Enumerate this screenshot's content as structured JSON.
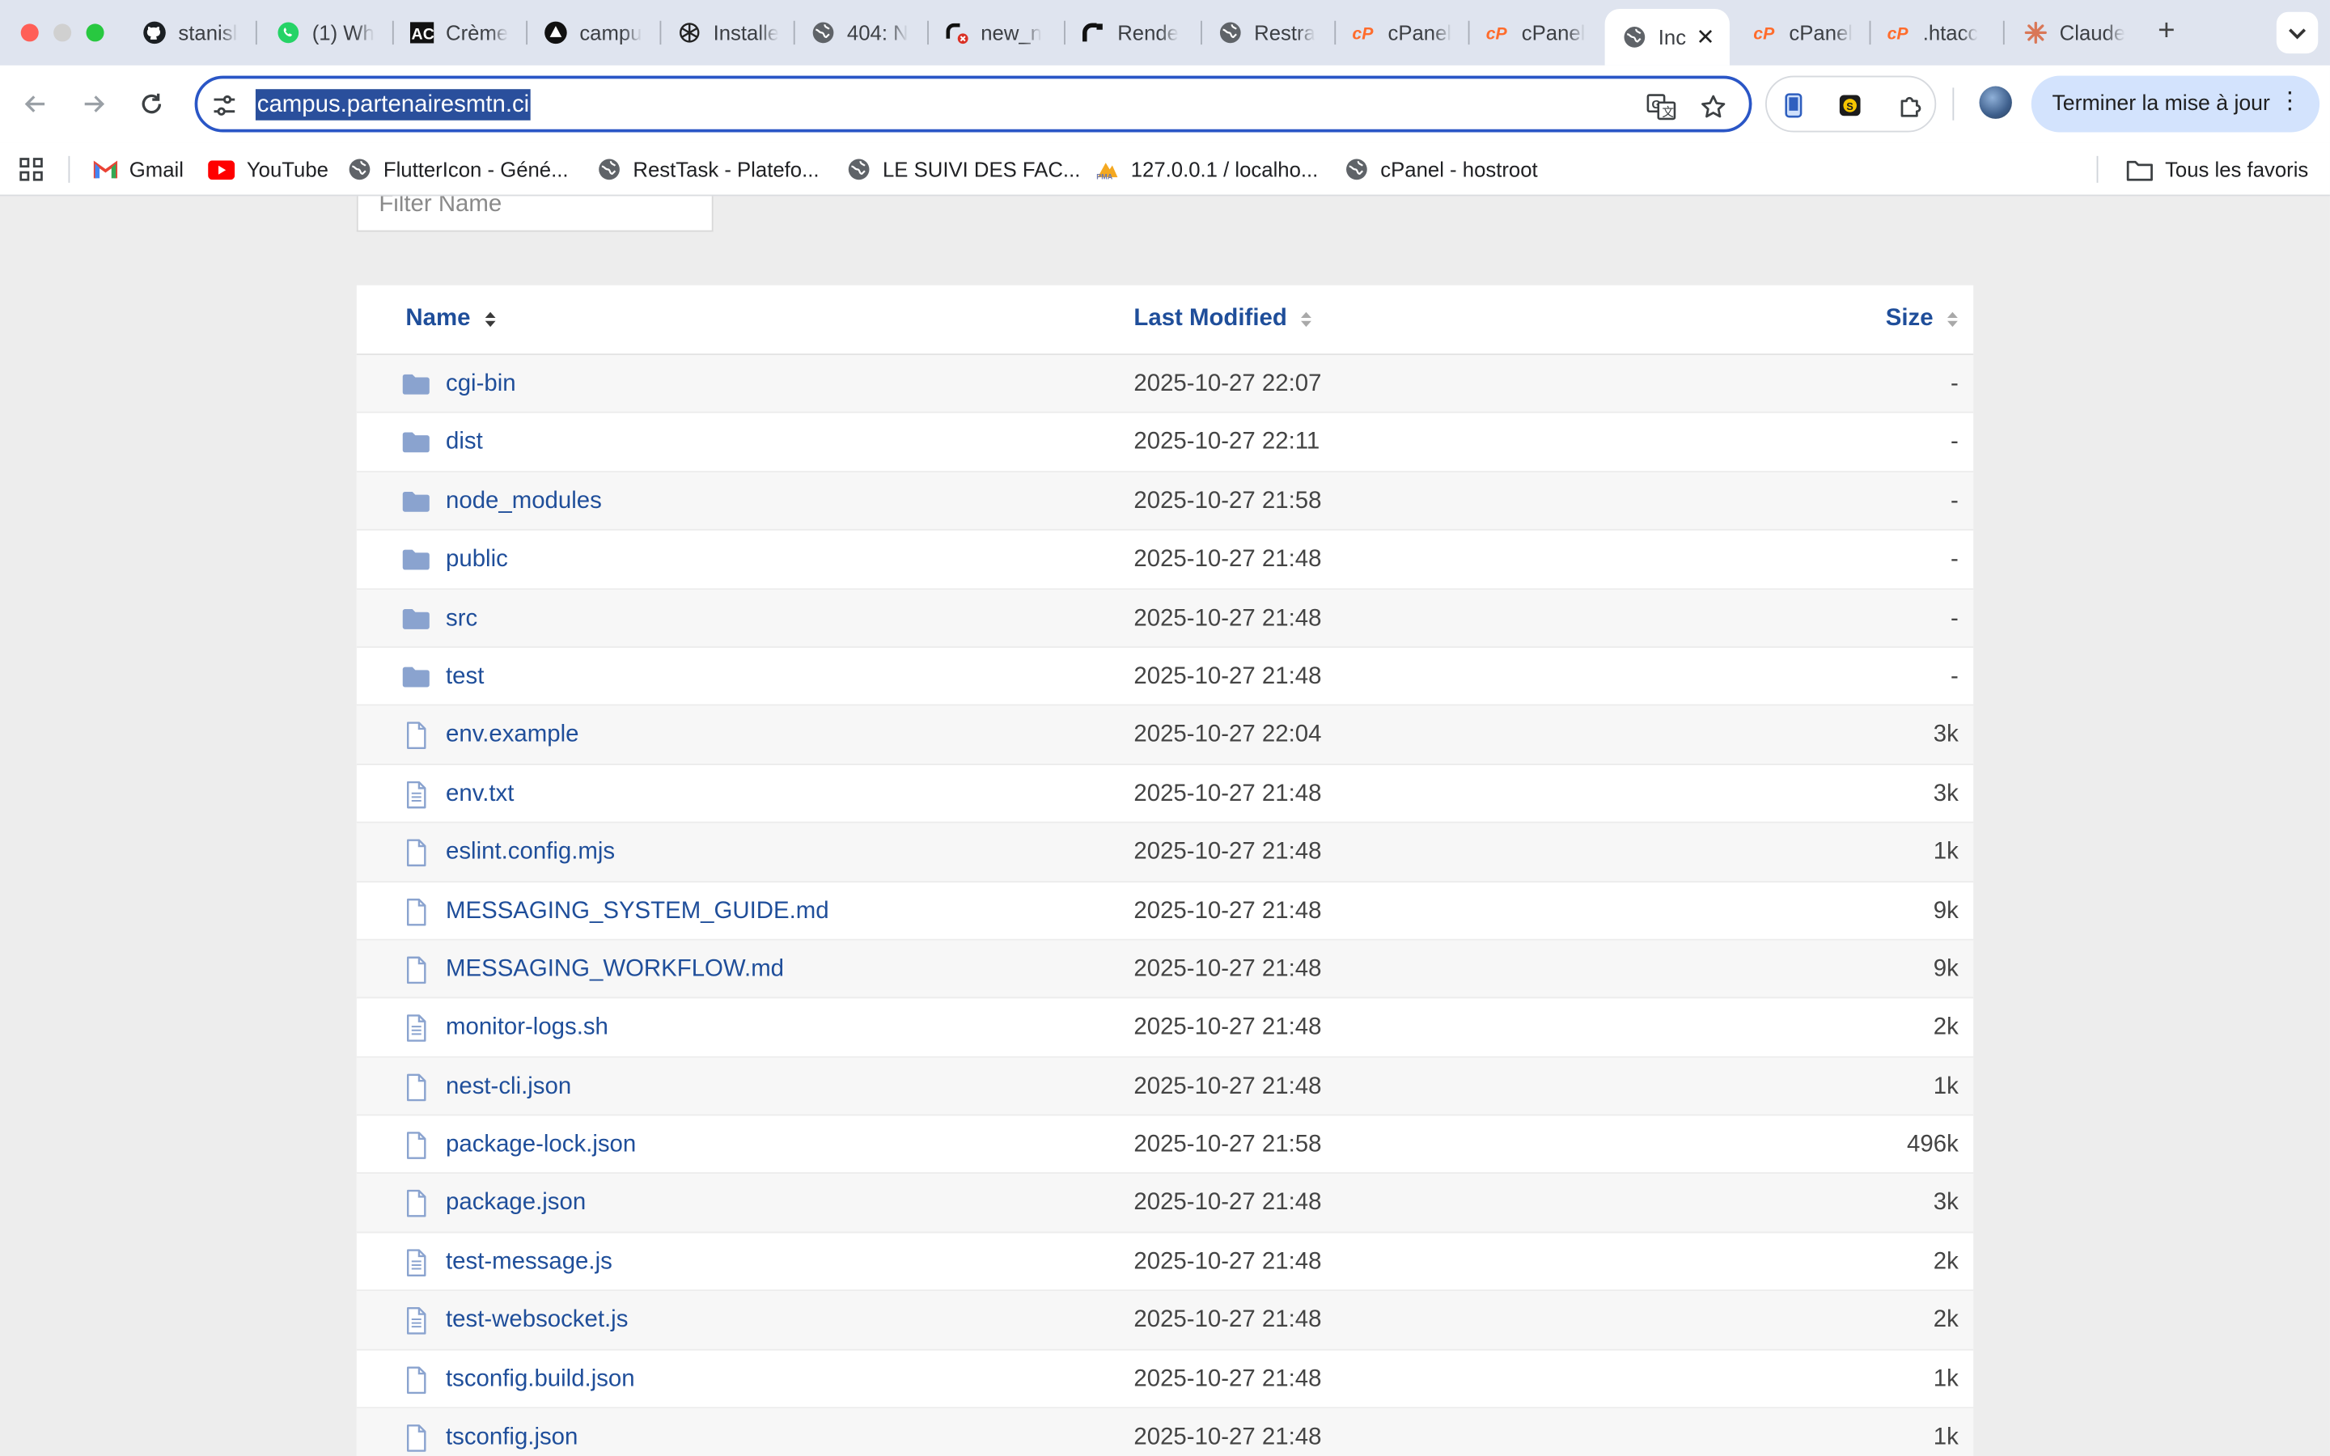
{
  "browser": {
    "tabs": [
      {
        "title": "stanisl",
        "icon": "github-icon"
      },
      {
        "title": "(1) Wh",
        "icon": "whatsapp-icon"
      },
      {
        "title": "Crème",
        "icon": "ac-logo-icon"
      },
      {
        "title": "campu",
        "icon": "app-logo-icon"
      },
      {
        "title": "Installe",
        "icon": "openai-icon"
      },
      {
        "title": "404: N",
        "icon": "globe-icon"
      },
      {
        "title": "new_n",
        "icon": "render-error-icon"
      },
      {
        "title": "Rende",
        "icon": "render-icon"
      },
      {
        "title": "Restra",
        "icon": "globe-icon"
      },
      {
        "title": "cPanel",
        "icon": "cpanel-icon"
      },
      {
        "title": "cPanel",
        "icon": "cpanel-icon"
      },
      {
        "title": "Inc",
        "icon": "globe-icon",
        "active": true
      },
      {
        "title": "cPanel",
        "icon": "cpanel-icon"
      },
      {
        "title": ".htacc",
        "icon": "cpanel-icon"
      },
      {
        "title": "Claude",
        "icon": "claude-icon"
      }
    ],
    "address_bar": {
      "url": "campus.partenairesmtn.ci"
    },
    "update_button": "Terminer la mise à jour",
    "bookmarks": [
      {
        "label": "Gmail",
        "icon": "gmail-icon"
      },
      {
        "label": "YouTube",
        "icon": "youtube-icon"
      },
      {
        "label": "FlutterIcon - Géné...",
        "icon": "globe-icon"
      },
      {
        "label": "RestTask - Platefo...",
        "icon": "globe-icon"
      },
      {
        "label": "LE SUIVI DES FAC...",
        "icon": "globe-icon"
      },
      {
        "label": "127.0.0.1 / localho...",
        "icon": "phpmyadmin-icon"
      },
      {
        "label": "cPanel - hostroot",
        "icon": "globe-icon"
      }
    ],
    "all_bookmarks": "Tous les favoris"
  },
  "page": {
    "filter": {
      "placeholder": "Filter Name"
    },
    "columns": {
      "name": "Name",
      "modified": "Last Modified",
      "size": "Size"
    },
    "rows": [
      {
        "name": "cgi-bin",
        "modified": "2025-10-27 22:07",
        "size": "-",
        "type": "folder"
      },
      {
        "name": "dist",
        "modified": "2025-10-27 22:11",
        "size": "-",
        "type": "folder"
      },
      {
        "name": "node_modules",
        "modified": "2025-10-27 21:58",
        "size": "-",
        "type": "folder"
      },
      {
        "name": "public",
        "modified": "2025-10-27 21:48",
        "size": "-",
        "type": "folder"
      },
      {
        "name": "src",
        "modified": "2025-10-27 21:48",
        "size": "-",
        "type": "folder"
      },
      {
        "name": "test",
        "modified": "2025-10-27 21:48",
        "size": "-",
        "type": "folder"
      },
      {
        "name": "env.example",
        "modified": "2025-10-27 22:04",
        "size": "3k",
        "type": "file"
      },
      {
        "name": "env.txt",
        "modified": "2025-10-27 21:48",
        "size": "3k",
        "type": "text-file"
      },
      {
        "name": "eslint.config.mjs",
        "modified": "2025-10-27 21:48",
        "size": "1k",
        "type": "file"
      },
      {
        "name": "MESSAGING_SYSTEM_GUIDE.md",
        "modified": "2025-10-27 21:48",
        "size": "9k",
        "type": "file"
      },
      {
        "name": "MESSAGING_WORKFLOW.md",
        "modified": "2025-10-27 21:48",
        "size": "9k",
        "type": "file"
      },
      {
        "name": "monitor-logs.sh",
        "modified": "2025-10-27 21:48",
        "size": "2k",
        "type": "text-file"
      },
      {
        "name": "nest-cli.json",
        "modified": "2025-10-27 21:48",
        "size": "1k",
        "type": "file"
      },
      {
        "name": "package-lock.json",
        "modified": "2025-10-27 21:58",
        "size": "496k",
        "type": "file"
      },
      {
        "name": "package.json",
        "modified": "2025-10-27 21:48",
        "size": "3k",
        "type": "file"
      },
      {
        "name": "test-message.js",
        "modified": "2025-10-27 21:48",
        "size": "2k",
        "type": "text-file"
      },
      {
        "name": "test-websocket.js",
        "modified": "2025-10-27 21:48",
        "size": "2k",
        "type": "text-file"
      },
      {
        "name": "tsconfig.build.json",
        "modified": "2025-10-27 21:48",
        "size": "1k",
        "type": "file"
      },
      {
        "name": "tsconfig.json",
        "modified": "2025-10-27 21:48",
        "size": "1k",
        "type": "file"
      }
    ]
  },
  "colors": {
    "link": "#1f4e9a",
    "folder": "#8aa3cf",
    "file_outline": "#8aa3cf",
    "selection": "#2a4f9c",
    "omnibox_border": "#2a56c6"
  }
}
